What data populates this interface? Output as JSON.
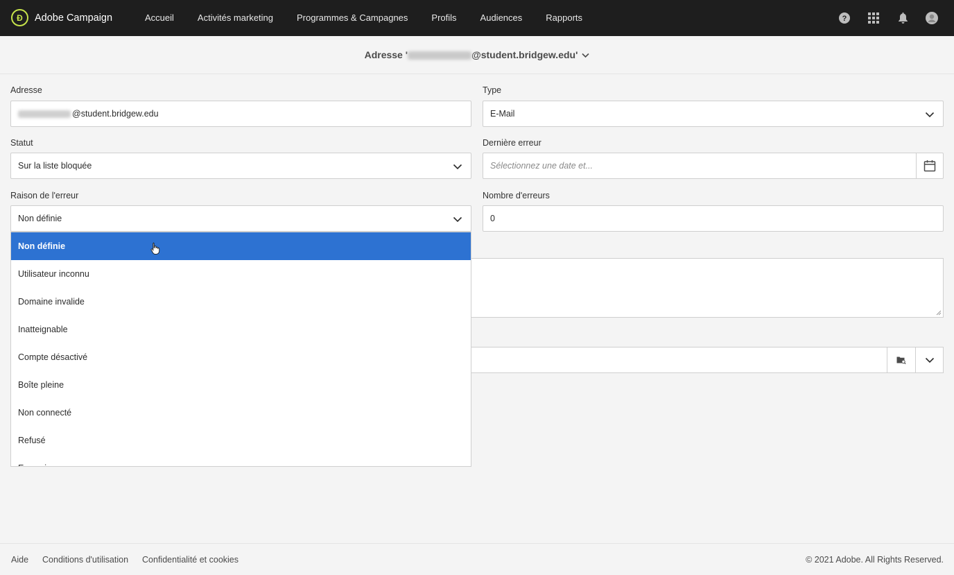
{
  "app": {
    "brand": "Adobe Campaign",
    "logo_mark": "Ɖ"
  },
  "nav": {
    "items": [
      "Accueil",
      "Activités marketing",
      "Programmes & Campagnes",
      "Profils",
      "Audiences",
      "Rapports"
    ]
  },
  "header": {
    "title_prefix": "Adresse '",
    "title_suffix": "@student.bridgew.edu'"
  },
  "form": {
    "address": {
      "label": "Adresse",
      "value_suffix": "@student.bridgew.edu"
    },
    "type": {
      "label": "Type",
      "value": "E-Mail"
    },
    "status": {
      "label": "Statut",
      "value": "Sur la liste bloquée"
    },
    "last_error": {
      "label": "Dernière erreur",
      "placeholder": "Sélectionnez une date et..."
    },
    "error_reason": {
      "label": "Raison de l'erreur",
      "value": "Non définie"
    },
    "error_count": {
      "label": "Nombre d'erreurs",
      "value": "0"
    }
  },
  "dropdown": {
    "options": [
      "Non définie",
      "Utilisateur inconnu",
      "Domaine invalide",
      "Inatteignable",
      "Compte désactivé",
      "Boîte pleine",
      "Non connecté",
      "Refusé",
      "Erreur inconnue"
    ],
    "selected_index": 0
  },
  "footer": {
    "links": [
      "Aide",
      "Conditions d'utilisation",
      "Confidentialité et cookies"
    ],
    "copyright": "© 2021 Adobe. All Rights Reserved."
  },
  "colors": {
    "topbar": "#1e1e1e",
    "accent": "#c6e34a",
    "selection": "#2d72d2"
  }
}
